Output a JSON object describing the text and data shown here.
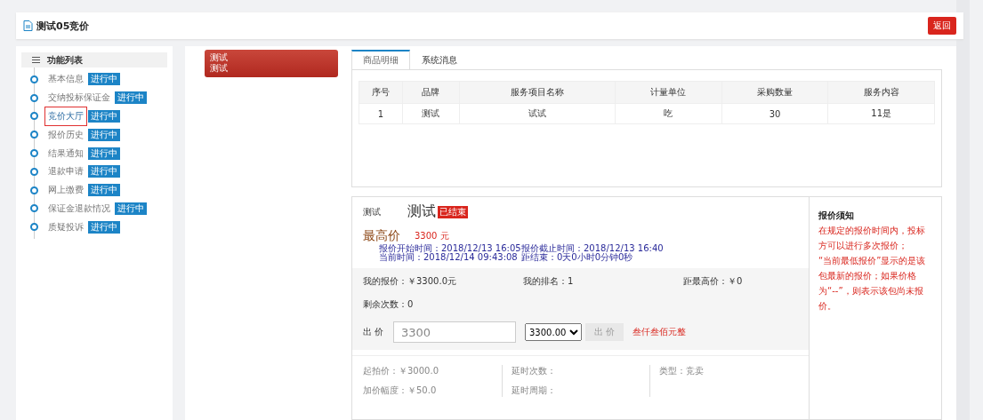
{
  "header": {
    "title": "测试05竞价",
    "back_button": "返回"
  },
  "sidebar": {
    "title": "功能列表",
    "items": [
      {
        "label": "基本信息",
        "badge": "进行中",
        "selected": false
      },
      {
        "label": "交纳投标保证金",
        "badge": "进行中",
        "selected": false
      },
      {
        "label": "竞价大厅",
        "badge": "进行中",
        "selected": true
      },
      {
        "label": "报价历史",
        "badge": "进行中",
        "selected": false
      },
      {
        "label": "结果通知",
        "badge": "进行中",
        "selected": false
      },
      {
        "label": "退款申请",
        "badge": "进行中",
        "selected": false
      },
      {
        "label": "网上缴费",
        "badge": "进行中",
        "selected": false
      },
      {
        "label": "保证金退款情况",
        "badge": "进行中",
        "selected": false
      },
      {
        "label": "质疑投诉",
        "badge": "进行中",
        "selected": false
      }
    ]
  },
  "project_card": {
    "lines": [
      "测试",
      "测试"
    ]
  },
  "tabs": [
    {
      "label": "商品明细",
      "selected": true
    },
    {
      "label": "系统消息",
      "selected": false
    }
  ],
  "table": {
    "columns": [
      "序号",
      "品牌",
      "服务项目名称",
      "计量单位",
      "采购数量",
      "服务内容"
    ],
    "rows": [
      [
        "1",
        "测试",
        "试试",
        "吃",
        "30",
        "11是"
      ]
    ]
  },
  "auction": {
    "small_title": "测试",
    "title": "测试",
    "status_badge": "已结束",
    "price_label": "最高价",
    "price": "3300 元",
    "times": [
      "报价开始时间：2018/12/13 16:05",
      "报价截止时间：2018/12/13 16:40",
      "当前时间：2018/12/14 09:43:08",
      "距结束：0天0小时0分钟0秒"
    ],
    "stats": [
      "我的报价：￥3300.0元",
      "我的排名：1",
      "距最高价：￥0"
    ],
    "remaining": "剩余次数：0",
    "bid_label": "出 价",
    "bid_value": "3300",
    "select_value": "3300.00",
    "bid_button": "出 价",
    "amount_words": "叁仟叁佰元整",
    "info": [
      [
        "起拍价：￥3000.0",
        "加价幅度：￥50.0"
      ],
      [
        "延时次数：",
        "延时周期："
      ],
      [
        "类型：竞卖"
      ]
    ]
  },
  "notice": {
    "title": "报价须知",
    "lines": [
      "在规定的报价时间内，投标方可以进行多次报价；",
      "“当前最低报价”显示的是该包最新的报价；如果价格为“--”，则表示该包尚未报价。"
    ]
  }
}
